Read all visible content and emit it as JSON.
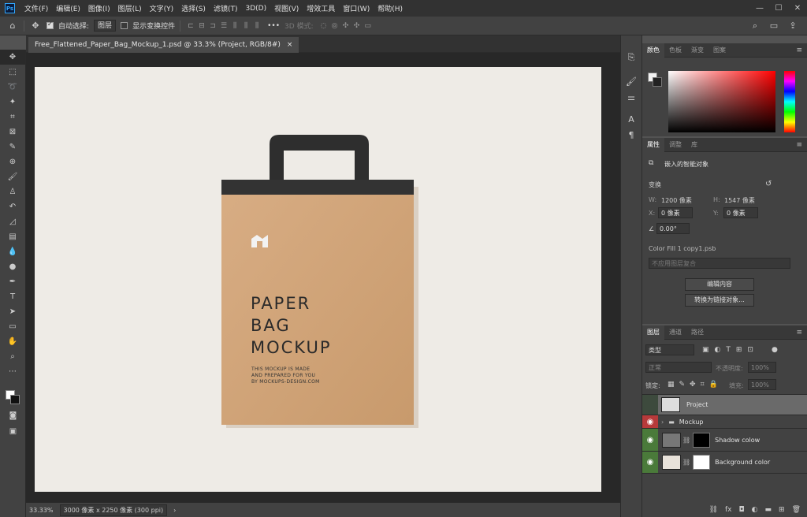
{
  "app": {
    "logo": "Ps"
  },
  "menu": [
    "文件(F)",
    "编辑(E)",
    "图像(I)",
    "图层(L)",
    "文字(Y)",
    "选择(S)",
    "滤镜(T)",
    "3D(D)",
    "视图(V)",
    "增效工具",
    "窗口(W)",
    "帮助(H)"
  ],
  "window_controls": {
    "minimize": "—",
    "maximize": "☐",
    "close": "✕"
  },
  "options": {
    "auto_select_label": "自动选择:",
    "auto_select_value": "图层",
    "show_transform_label": "显示变换控件",
    "more": "•••",
    "mode_3d": "3D 模式:"
  },
  "document_tab": {
    "title": "Free_Flattened_Paper_Bag_Mockup_1.psd @ 33.3% (Project, RGB/8#)",
    "close": "×"
  },
  "bag": {
    "title_lines": [
      "PAPER",
      "BAG",
      "MOCKUP"
    ],
    "small_lines": [
      "THIS MOCKUP IS MADE",
      "AND PREPARED FOR YOU",
      "BY MOCKUPS-DESIGN.COM"
    ]
  },
  "status": {
    "zoom": "33.33%",
    "doc_info": "3000 像素 x 2250 像素 (300 ppi)",
    "arrow": "›"
  },
  "color_panel": {
    "tabs": [
      "颜色",
      "色板",
      "渐变",
      "图案"
    ]
  },
  "properties_panel": {
    "tabs": [
      "属性",
      "调整",
      "库"
    ],
    "type_label": "嵌入的智能对象",
    "transform_label": "变换",
    "w_label": "W:",
    "w_value": "1200 像素",
    "h_label": "H:",
    "h_value": "1547 像素",
    "x_label": "X:",
    "x_value": "0 像素",
    "y_label": "Y:",
    "y_value": "0 像素",
    "angle_value": "0.00°",
    "file_name": "Color Fill 1 copy1.psb",
    "comp_placeholder": "不应用图层复合",
    "edit_button": "编辑内容",
    "convert_button": "转换为链接对象..."
  },
  "layers_panel": {
    "tabs": [
      "图层",
      "通道",
      "路径"
    ],
    "filter_label": "类型",
    "blend_mode": "正常",
    "opacity_label": "不透明度:",
    "opacity_value": "100%",
    "lock_label": "锁定:",
    "fill_label": "填充:",
    "fill_value": "100%",
    "layers": [
      {
        "name": "Project"
      },
      {
        "name": "Mockup"
      },
      {
        "name": "Shadow colow"
      },
      {
        "name": "Background color"
      }
    ],
    "footer_icons": [
      "link-icon",
      "fx-icon",
      "mask-icon",
      "adjustment-icon",
      "folder-icon",
      "new-layer-icon",
      "trash-icon"
    ]
  }
}
